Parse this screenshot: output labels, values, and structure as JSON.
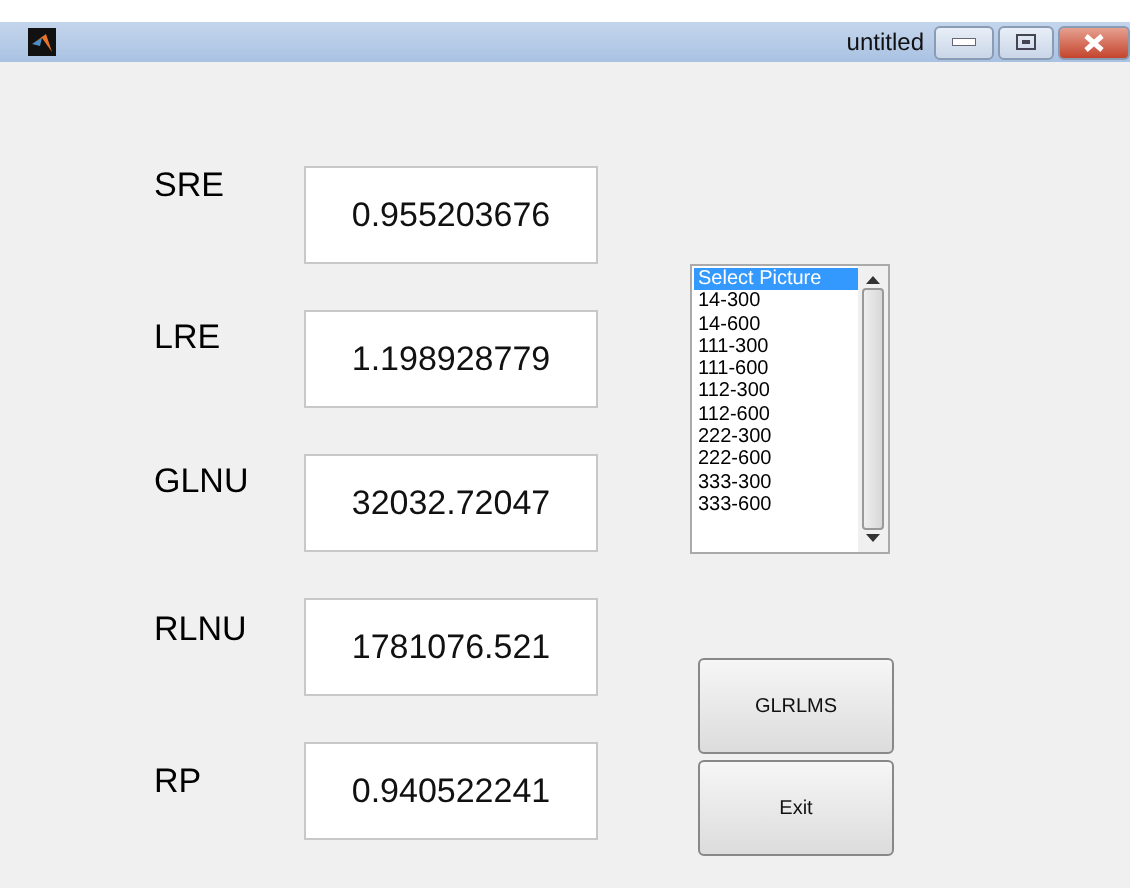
{
  "window": {
    "title": "untitled"
  },
  "measures": [
    {
      "label": "SRE",
      "value": "0.955203676"
    },
    {
      "label": "LRE",
      "value": "1.198928779"
    },
    {
      "label": "GLNU",
      "value": "32032.72047"
    },
    {
      "label": "RLNU",
      "value": "1781076.521"
    },
    {
      "label": "RP",
      "value": "0.940522241"
    }
  ],
  "picture_list": [
    {
      "label": "Select Picture",
      "selected": true
    },
    {
      "label": "14-300",
      "selected": false
    },
    {
      "label": "14-600",
      "selected": false
    },
    {
      "label": "111-300",
      "selected": false
    },
    {
      "label": "111-600",
      "selected": false
    },
    {
      "label": "112-300",
      "selected": false
    },
    {
      "label": "112-600",
      "selected": false
    },
    {
      "label": "222-300",
      "selected": false
    },
    {
      "label": "222-600",
      "selected": false
    },
    {
      "label": "333-300",
      "selected": false
    },
    {
      "label": "333-600",
      "selected": false
    }
  ],
  "buttons": [
    "GLRLMS",
    "Exit"
  ]
}
